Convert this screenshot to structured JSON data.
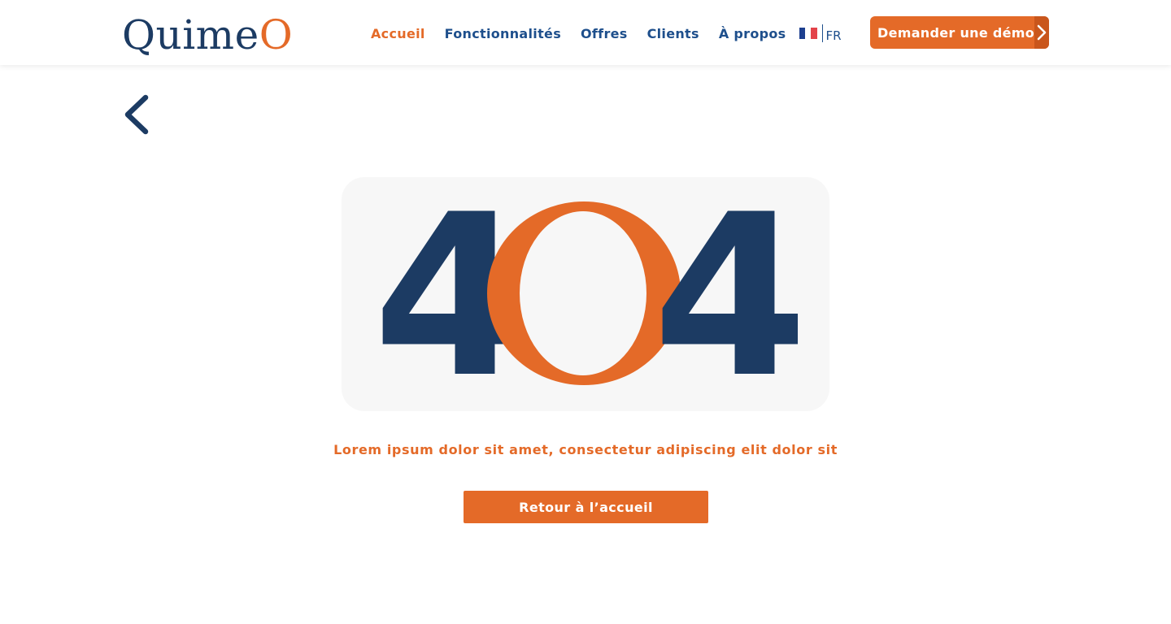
{
  "brand": {
    "logo_part1": "Quime",
    "logo_part2": "O",
    "navy": "#1c3b63",
    "orange": "#e46a28"
  },
  "nav": {
    "items": [
      {
        "label": "Accueil",
        "active": true
      },
      {
        "label": "Fonctionnalités",
        "active": false
      },
      {
        "label": "Offres",
        "active": false
      },
      {
        "label": "Clients",
        "active": false
      },
      {
        "label": "À propos",
        "active": false
      }
    ],
    "language": {
      "label": "FR",
      "flag_icon": "france-flag-icon"
    }
  },
  "cta": {
    "label": "Demander une démo",
    "icon": "chevron-right-icon"
  },
  "back": {
    "icon": "chevron-left-icon"
  },
  "error": {
    "code_first": "4",
    "code_middle": "O",
    "code_last": "4",
    "message": "Lorem ipsum dolor sit amet, consectetur adipiscing elit dolor sit",
    "button_label": "Retour à l’accueil"
  }
}
